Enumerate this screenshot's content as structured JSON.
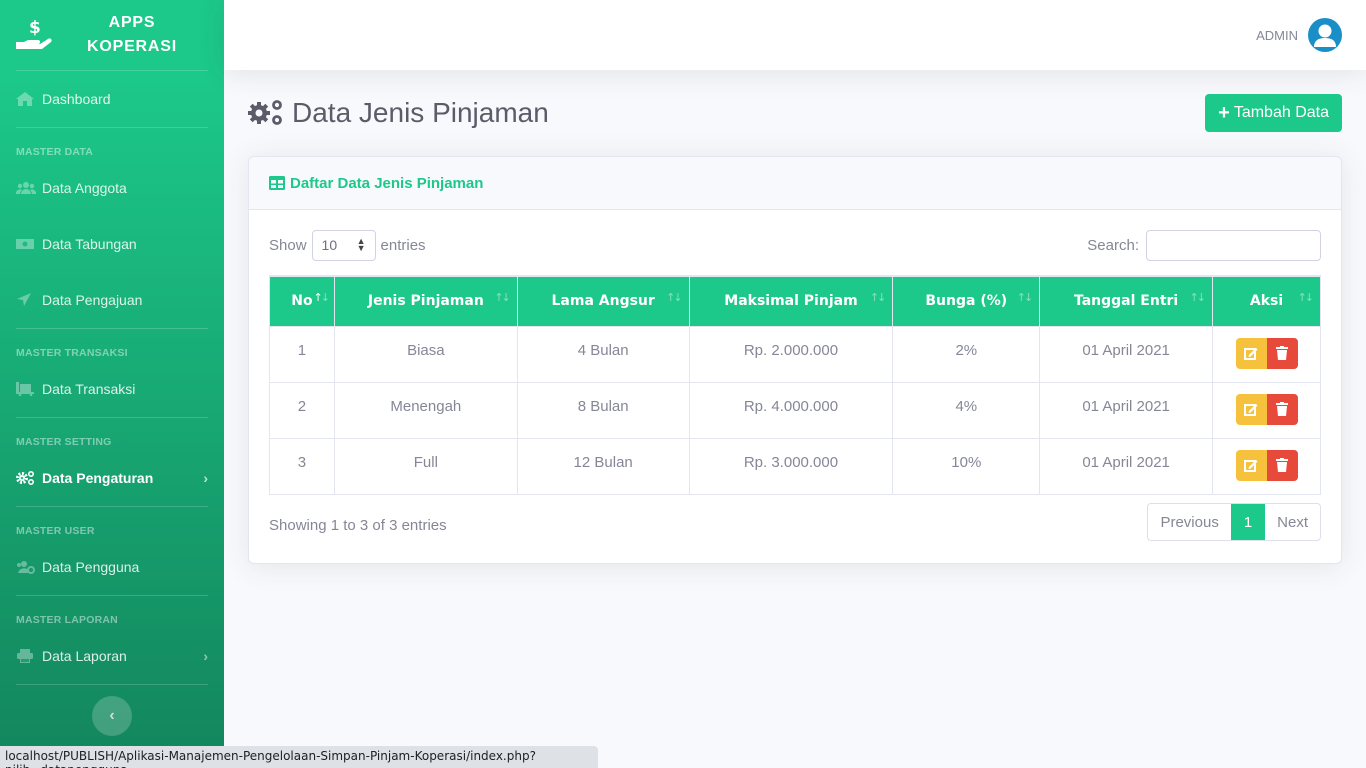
{
  "sidebar": {
    "brand": {
      "line1": "APPS",
      "line2": "KOPERASI",
      "icon": "hand-dollar-icon"
    },
    "dashboard": {
      "label": "Dashboard",
      "icon": "home-icon"
    },
    "sections": [
      {
        "heading": "MASTER DATA",
        "items": [
          {
            "label": "Data Anggota",
            "icon": "users-icon"
          },
          {
            "label": "Data Tabungan",
            "icon": "money-bill-icon"
          },
          {
            "label": "Data Pengajuan",
            "icon": "location-arrow-icon"
          }
        ]
      },
      {
        "heading": "MASTER TRANSAKSI",
        "items": [
          {
            "label": "Data Transaksi",
            "icon": "dolly-icon"
          }
        ]
      },
      {
        "heading": "MASTER SETTING",
        "items": [
          {
            "label": "Data Pengaturan",
            "icon": "cogs-icon",
            "active": true,
            "chevron": "›"
          }
        ]
      },
      {
        "heading": "MASTER USER",
        "items": [
          {
            "label": "Data Pengguna",
            "icon": "users-cog-icon"
          }
        ]
      },
      {
        "heading": "MASTER LAPORAN",
        "items": [
          {
            "label": "Data Laporan",
            "icon": "print-icon",
            "chevron": "›"
          }
        ]
      }
    ],
    "toggle": "‹"
  },
  "topbar": {
    "user_name": "ADMIN",
    "avatar_icon": "user-circle-icon"
  },
  "page": {
    "title": "Data Jenis Pinjaman",
    "title_icon": "cogs-icon",
    "add_button": "Tambah Data"
  },
  "card": {
    "title": "Daftar Data Jenis Pinjaman",
    "length": {
      "prefix": "Show",
      "value": "10",
      "suffix": "entries"
    },
    "search": {
      "label": "Search:",
      "value": "",
      "placeholder": ""
    },
    "table": {
      "columns": [
        "No",
        "Jenis Pinjaman",
        "Lama Angsur",
        "Maksimal Pinjam",
        "Bunga (%)",
        "Tanggal Entri",
        "Aksi"
      ],
      "rows": [
        [
          "1",
          "Biasa",
          "4 Bulan",
          "Rp. 2.000.000",
          "2%",
          "01 April 2021"
        ],
        [
          "2",
          "Menengah",
          "8 Bulan",
          "Rp. 4.000.000",
          "4%",
          "01 April 2021"
        ],
        [
          "3",
          "Full",
          "12 Bulan",
          "Rp. 3.000.000",
          "10%",
          "01 April 2021"
        ]
      ]
    },
    "info": "Showing 1 to 3 of 3 entries",
    "pagination": {
      "previous": "Previous",
      "current": "1",
      "next": "Next"
    }
  },
  "colors": {
    "primary": "#1cc88a",
    "warning": "#f6c23e",
    "danger": "#e74a3b",
    "avatar": "#1a8fc7"
  },
  "statusbar": {
    "url": "localhost/PUBLISH/Aplikasi-Manajemen-Pengelolaan-Simpan-Pinjam-Koperasi/index.php?pilih=datapengguna"
  }
}
